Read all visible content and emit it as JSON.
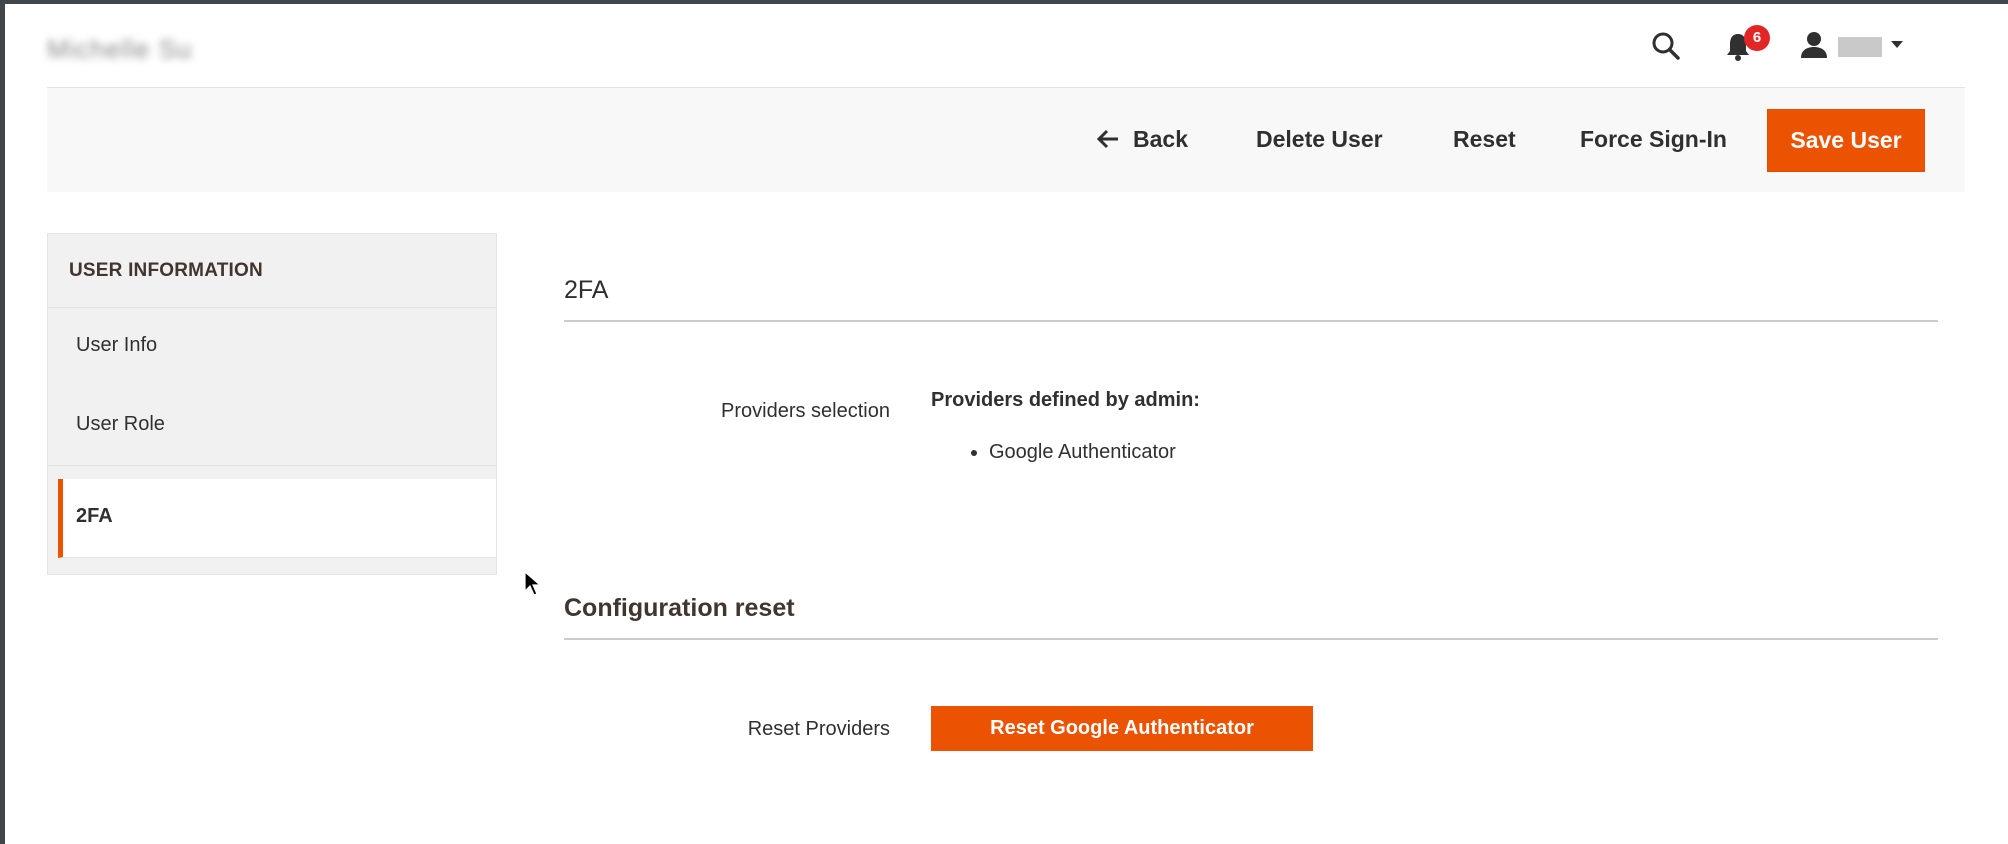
{
  "header": {
    "page_title": "Michelle Su",
    "notification_count": "6",
    "user_name": "user"
  },
  "actions": {
    "back_label": "Back",
    "delete_label": "Delete User",
    "reset_label": "Reset",
    "force_signin_label": "Force Sign-In",
    "save_label": "Save User"
  },
  "sidebar": {
    "title": "USER INFORMATION",
    "items": [
      {
        "label": "User Info",
        "active": false
      },
      {
        "label": "User Role",
        "active": false
      },
      {
        "label": "2FA",
        "active": true
      }
    ]
  },
  "main": {
    "section_2fa_title": "2FA",
    "providers_label": "Providers selection",
    "providers_heading": "Providers defined by admin:",
    "providers": [
      "Google Authenticator"
    ],
    "section_reset_title": "Configuration reset",
    "reset_label": "Reset Providers",
    "reset_button": "Reset Google Authenticator"
  },
  "colors": {
    "accent": "#eb5202",
    "badge": "#e22626"
  }
}
